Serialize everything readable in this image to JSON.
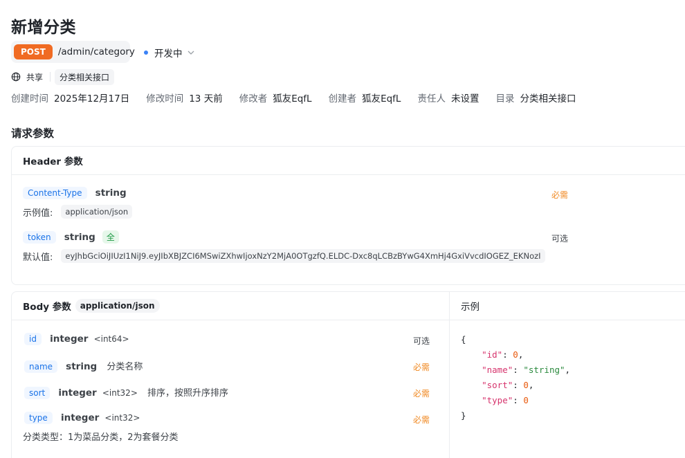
{
  "page": {
    "title": "新增分类"
  },
  "endpoint": {
    "method": "POST",
    "path": "/admin/category",
    "status": "开发中"
  },
  "share": {
    "label": "共享",
    "folder": "分类相关接口"
  },
  "meta": [
    {
      "key": "创建时间",
      "value": "2025年12月17日"
    },
    {
      "key": "修改时间",
      "value": "13 天前"
    },
    {
      "key": "修改者",
      "value": "狐友EqfL"
    },
    {
      "key": "创建者",
      "value": "狐友EqfL"
    },
    {
      "key": "责任人",
      "value": "未设置"
    },
    {
      "key": "目录",
      "value": "分类相关接口"
    }
  ],
  "request": {
    "title": "请求参数",
    "header": {
      "title": "Header 参数",
      "params": [
        {
          "name": "Content-Type",
          "type": "string",
          "required_label": "必需",
          "example_label": "示例值:",
          "example_value": "application/json"
        },
        {
          "name": "token",
          "type": "string",
          "tag": "全",
          "required_label": "可选",
          "default_label": "默认值:",
          "default_value": "eyJhbGciOiJIUzI1NiJ9.eyJIbXBJZCI6MSwiZXhwIjoxNzY2MjA0OTgzfQ.ELDC-Dxc8qLCBzBYwG4XmHj4GxiVvcdIOGEZ_EKNozI"
        }
      ]
    },
    "body": {
      "title": "Body 参数",
      "content_type": "application/json",
      "params": [
        {
          "name": "id",
          "type": "integer",
          "format": "<int64>",
          "desc": "",
          "required_label": "可选"
        },
        {
          "name": "name",
          "type": "string",
          "format": "",
          "desc": "分类名称",
          "required_label": "必需"
        },
        {
          "name": "sort",
          "type": "integer",
          "format": "<int32>",
          "desc": "排序，按照升序排序",
          "required_label": "必需"
        },
        {
          "name": "type",
          "type": "integer",
          "format": "<int32>",
          "desc": "",
          "required_label": "必需",
          "sub_desc": "分类类型：1为菜品分类，2为套餐分类"
        }
      ]
    },
    "example": {
      "title": "示例",
      "lines": [
        {
          "key": "",
          "val": "{",
          "kind": "brace"
        },
        {
          "key": "\"id\"",
          "val": "0",
          "kind": "num",
          "comma": ","
        },
        {
          "key": "\"name\"",
          "val": "\"string\"",
          "kind": "str",
          "comma": ","
        },
        {
          "key": "\"sort\"",
          "val": "0",
          "kind": "num",
          "comma": ","
        },
        {
          "key": "\"type\"",
          "val": "0",
          "kind": "num",
          "comma": ""
        },
        {
          "key": "",
          "val": "}",
          "kind": "brace"
        }
      ]
    }
  },
  "colors": {
    "method": "#f06b23",
    "status_dot": "#3b82f6",
    "required": "#f08a24",
    "param_name": "#1a73e8"
  }
}
